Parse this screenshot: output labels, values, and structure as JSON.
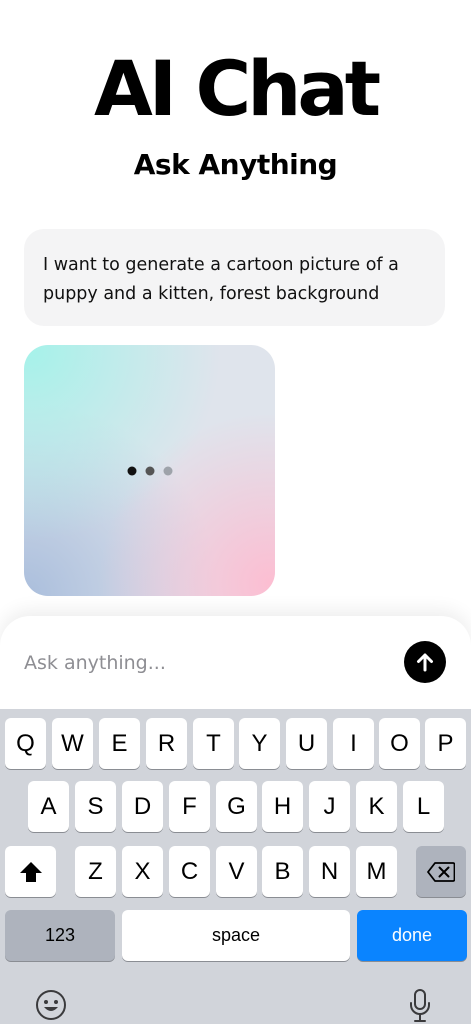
{
  "header": {
    "title": "AI Chat",
    "subtitle": "Ask Anything"
  },
  "chat": {
    "user_message": "I want to generate a cartoon picture of a puppy and a kitten, forest background"
  },
  "composer": {
    "placeholder": "Ask anything..."
  },
  "keyboard": {
    "row1": [
      "Q",
      "W",
      "E",
      "R",
      "T",
      "Y",
      "U",
      "I",
      "O",
      "P"
    ],
    "row2": [
      "A",
      "S",
      "D",
      "F",
      "G",
      "H",
      "J",
      "K",
      "L"
    ],
    "row3": [
      "Z",
      "X",
      "C",
      "V",
      "B",
      "N",
      "M"
    ],
    "numbers_label": "123",
    "space_label": "space",
    "done_label": "done"
  },
  "colors": {
    "accent": "#0a84ff",
    "send_button": "#000000",
    "bubble": "#f4f4f5"
  },
  "icons": {
    "send": "arrow-up-icon",
    "shift": "shift-icon",
    "delete": "backspace-icon",
    "emoji": "emoji-icon",
    "mic": "microphone-icon"
  }
}
